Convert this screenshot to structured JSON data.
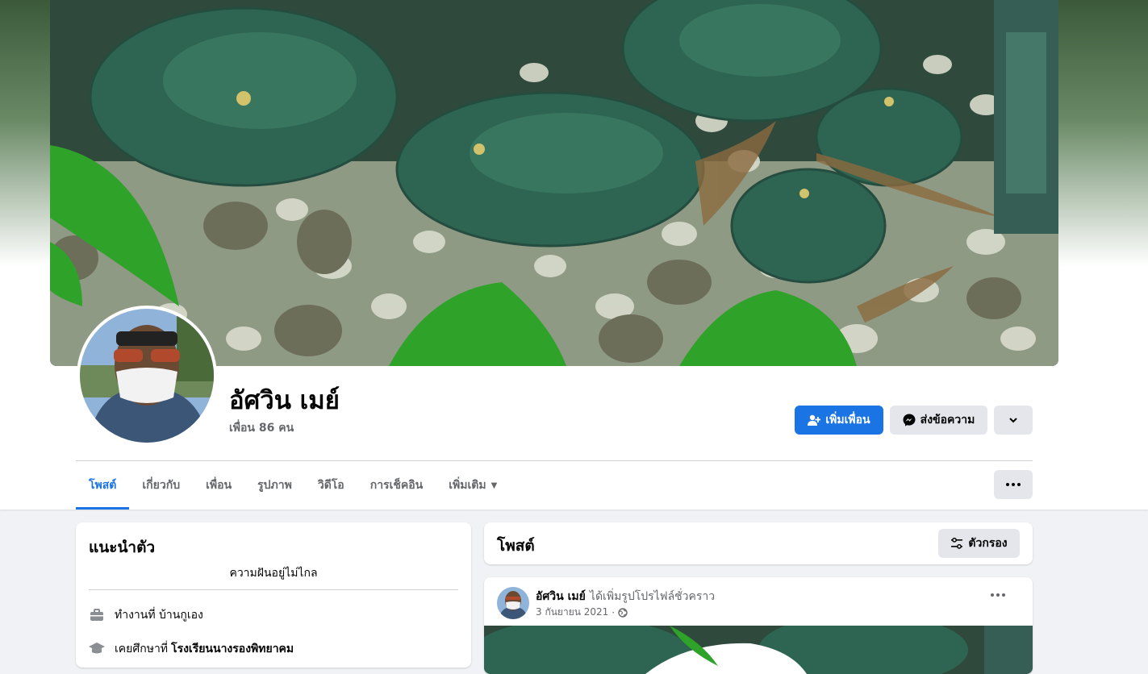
{
  "profile": {
    "name": "อัศวิน เมย์",
    "friends_count": "เพื่อน 86 คน"
  },
  "actions": {
    "add_friend": "เพิ่มเพื่อน",
    "message": "ส่งข้อความ"
  },
  "tabs": [
    {
      "label": "โพสต์",
      "active": true
    },
    {
      "label": "เกี่ยวกับ",
      "active": false
    },
    {
      "label": "เพื่อน",
      "active": false
    },
    {
      "label": "รูปภาพ",
      "active": false
    },
    {
      "label": "วิดีโอ",
      "active": false
    },
    {
      "label": "การเช็คอิน",
      "active": false
    },
    {
      "label": "เพิ่มเติม",
      "active": false
    }
  ],
  "intro": {
    "title": "แนะนำตัว",
    "bio": "ความฝันอยู่ไม่ไกล",
    "work": "ทำงานที่ บ้านกูเอง",
    "education_prefix": "เคยศึกษาที่",
    "education_school": "โรงเรียนนางรองพิทยาคม"
  },
  "posts": {
    "title": "โพสต์",
    "filter_label": "ตัวกรอง",
    "items": [
      {
        "author": "อัศวิน เมย์",
        "action": "ได้เพิ่มรูปโปรไฟล์ชั่วคราว",
        "date": "3 กันยายน 2021",
        "separator": "·"
      }
    ]
  },
  "colors": {
    "accent": "#1b74e4",
    "secondary_button": "#e4e6eb",
    "page_bg": "#f0f2f5",
    "muted_text": "#65676b"
  }
}
